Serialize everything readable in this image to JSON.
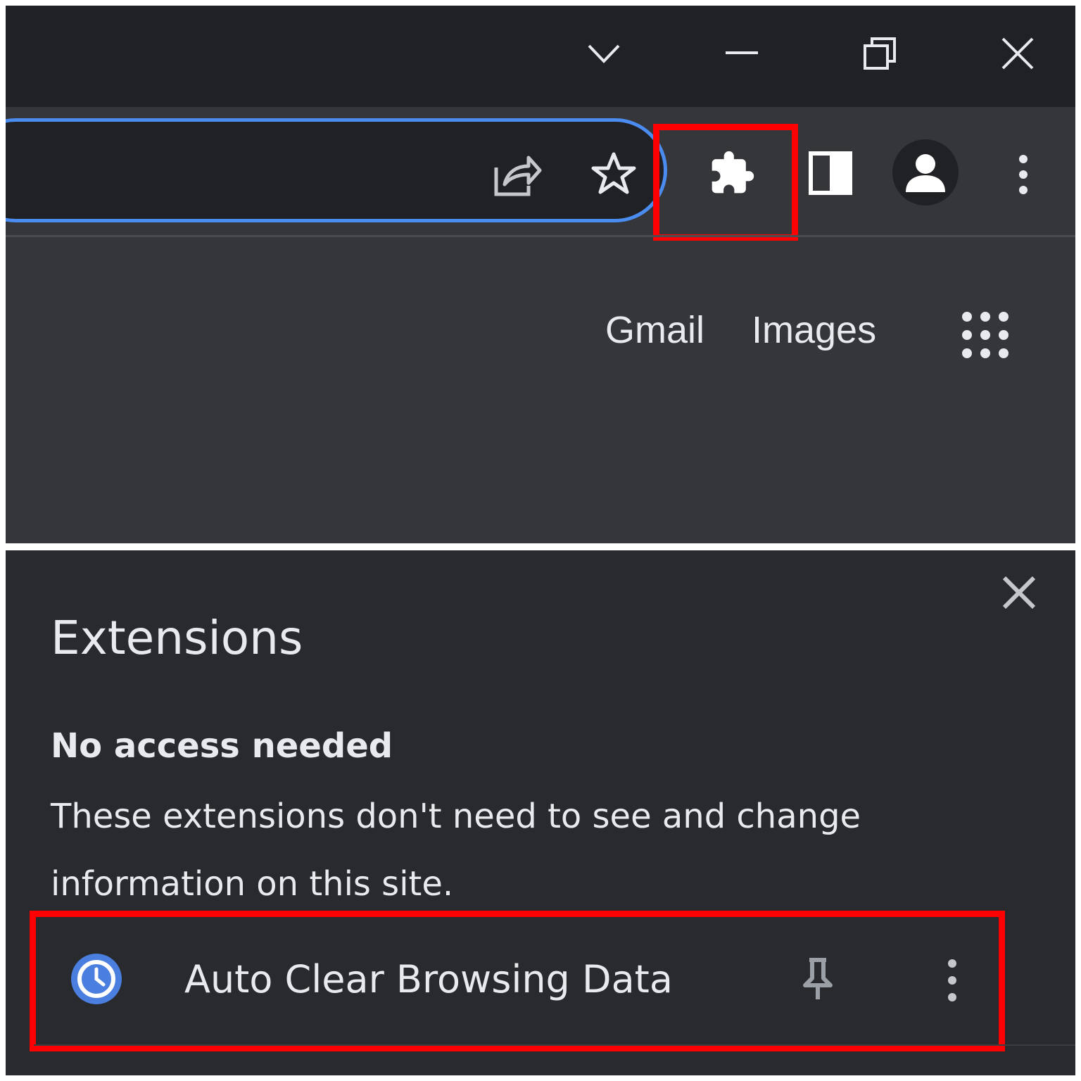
{
  "title_bar": {
    "icons": [
      "chevron-down-icon",
      "minimize-icon",
      "restore-icon",
      "close-icon"
    ]
  },
  "toolbar": {
    "omnibox_icons": [
      "share-icon",
      "star-icon"
    ],
    "icons": [
      "puzzle-icon",
      "side-panel-icon",
      "avatar-icon",
      "more-vert-icon"
    ],
    "highlight_color": "#ff0000",
    "focus_ring_color": "#4a8cf0"
  },
  "ntp": {
    "links": [
      "Gmail",
      "Images"
    ],
    "apps_icon": "apps-grid-icon"
  },
  "extensions_popup": {
    "title": "Extensions",
    "section_heading": "No access needed",
    "section_description": "These extensions don't need to see and change information on this site.",
    "items": [
      {
        "name": "Auto Clear Browsing Data",
        "icon": "clock-icon",
        "actions": [
          "pin-icon",
          "more-vert-icon"
        ]
      }
    ]
  }
}
